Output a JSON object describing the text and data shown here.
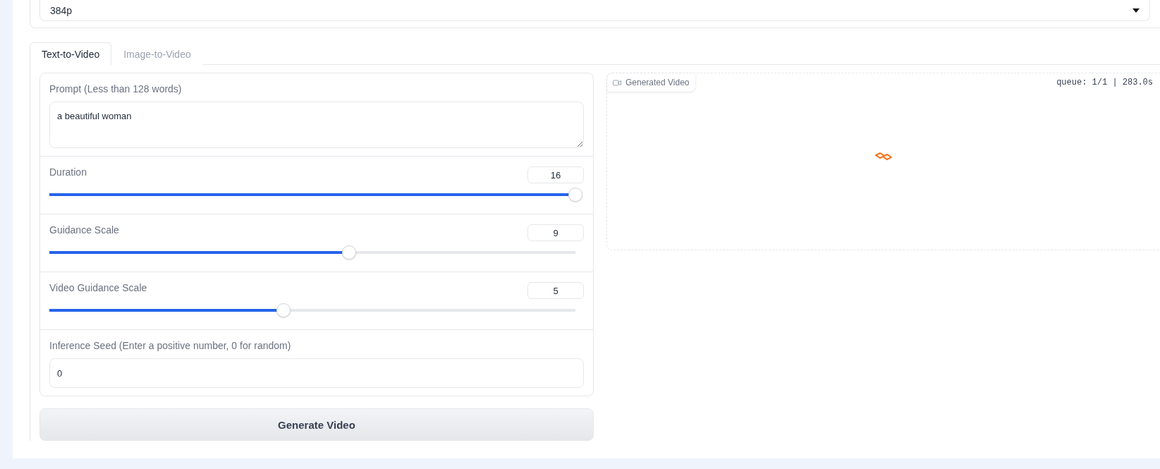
{
  "resolution_select": {
    "value": "384p"
  },
  "tabs": [
    {
      "label": "Text-to-Video",
      "selected": true
    },
    {
      "label": "Image-to-Video",
      "selected": false
    }
  ],
  "controls": [
    {
      "kind": "textarea",
      "label": "Prompt (Less than 128 words)",
      "value": "a beautiful woman"
    },
    {
      "kind": "slider",
      "label": "Duration",
      "value": "16",
      "level": 1.0
    },
    {
      "kind": "slider",
      "label": "Guidance Scale",
      "value": "9",
      "level": 0.57
    },
    {
      "kind": "slider",
      "label": "Video Guidance Scale",
      "value": "5",
      "level": 0.445
    },
    {
      "kind": "number",
      "label": "Inference Seed (Enter a positive number, 0 for random)",
      "value": "0"
    }
  ],
  "generate_button": {
    "label": "Generate Video"
  },
  "video_output": {
    "label": "Generated Video",
    "status": "queue: 1/1 | 283.0s"
  }
}
